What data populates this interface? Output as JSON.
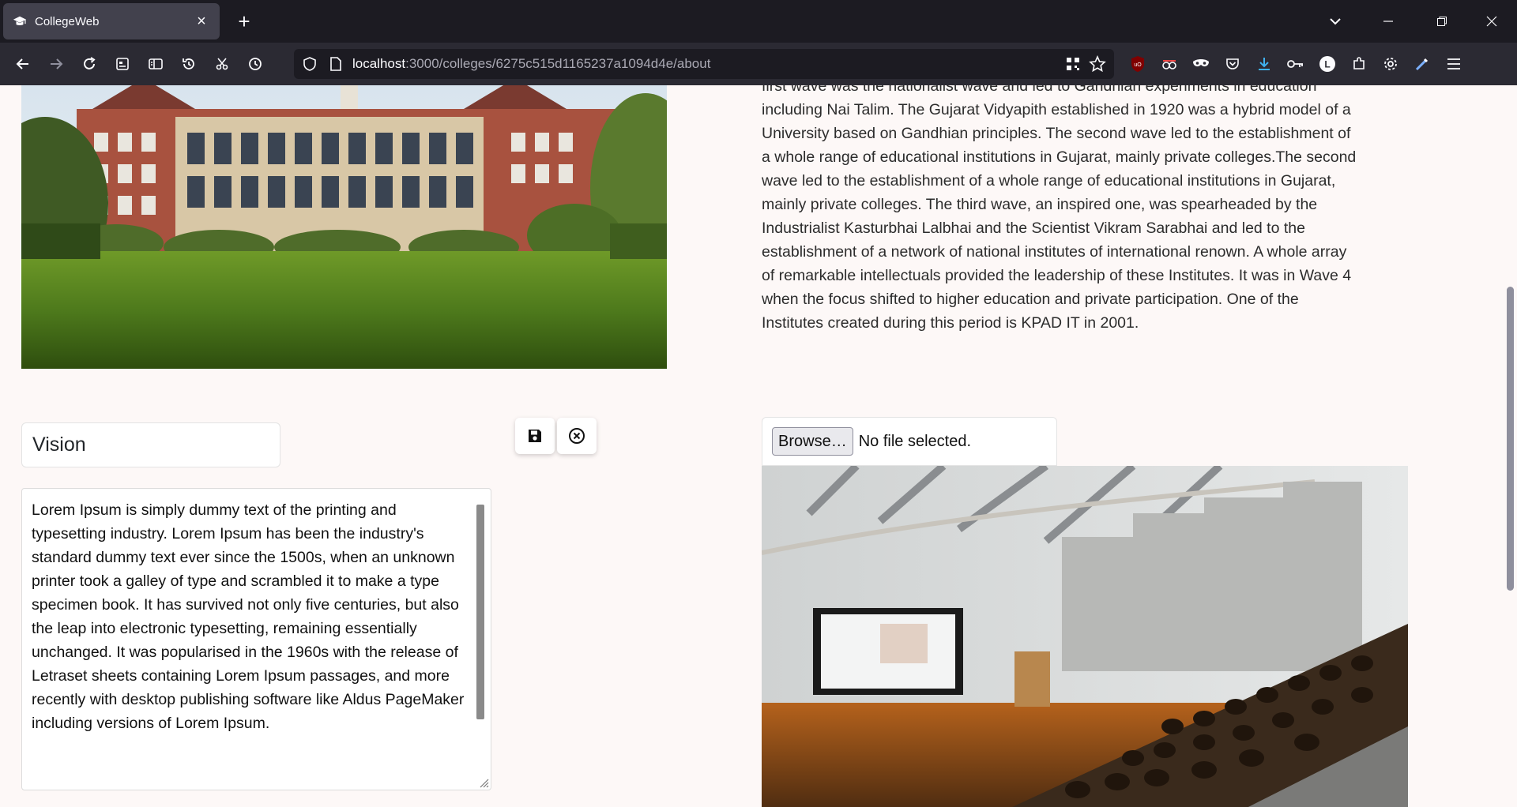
{
  "browser": {
    "tab_title": "CollegeWeb",
    "url_host": "localhost",
    "url_rest": ":3000/colleges/6275c515d1165237a1094d4e/about"
  },
  "page": {
    "history_text": "first wave was the nationalist wave and led to Gandhian experiments in education including Nai Talim. The Gujarat Vidyapith established in 1920 was a hybrid model of a University based on Gandhian principles. The second wave led to the establishment of a whole range of educational institutions in Gujarat, mainly private colleges.The second wave led to the establishment of a whole range of educational institutions in Gujarat, mainly private colleges. The third wave, an inspired one, was spearheaded by the Industrialist Kasturbhai Lalbhai and the Scientist Vikram Sarabhai and led to the establishment of a network of national institutes of international renown. A whole array of remarkable intellectuals provided the leadership of these Institutes. It was in Wave 4 when the focus shifted to higher education and private participation. One of the Institutes created during this period is KPAD IT in 2001.",
    "vision_title": "Vision",
    "vision_text": "Lorem Ipsum is simply dummy text of the printing and typesetting industry. Lorem Ipsum has been the industry's standard dummy text ever since the 1500s, when an unknown printer took a galley of type and scrambled it to make a type specimen book. It has survived not only five centuries, but also the leap into electronic typesetting, remaining essentially unchanged. It was popularised in the 1960s with the release of Letraset sheets containing Lorem Ipsum passages, and more recently with desktop publishing software like Aldus PageMaker including versions of Lorem Ipsum.",
    "browse_label": "Browse…",
    "file_status": "No file selected."
  },
  "icons": {
    "save": "save-icon",
    "cancel": "cancel-icon"
  },
  "colors": {
    "page_bg": "#fdf8f7",
    "chrome_bg": "#2b2a33",
    "tabbar_bg": "#1c1b22"
  }
}
